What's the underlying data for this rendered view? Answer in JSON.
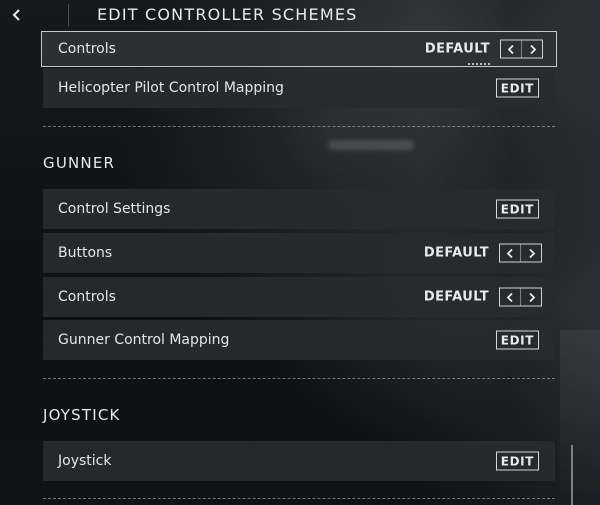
{
  "header": {
    "title": "EDIT CONTROLLER SCHEMES"
  },
  "rows": {
    "heli_controls": {
      "label": "Controls",
      "value": "DEFAULT"
    },
    "heli_mapping": {
      "label": "Helicopter Pilot Control Mapping",
      "action": "EDIT"
    },
    "gunner_settings": {
      "label": "Control Settings",
      "action": "EDIT"
    },
    "gunner_buttons": {
      "label": "Buttons",
      "value": "DEFAULT"
    },
    "gunner_controls": {
      "label": "Controls",
      "value": "DEFAULT"
    },
    "gunner_mapping": {
      "label": "Gunner Control Mapping",
      "action": "EDIT"
    },
    "joystick": {
      "label": "Joystick",
      "action": "EDIT"
    }
  },
  "sections": {
    "gunner": "GUNNER",
    "joystick": "JOYSTICK"
  },
  "icons": {
    "back": "chevron-left-icon",
    "prev": "chevron-left-icon",
    "next": "chevron-right-icon"
  },
  "colors": {
    "row_bg": "#262b2f",
    "focus_border": "#dce1e6",
    "text": "#e3e6e9"
  }
}
